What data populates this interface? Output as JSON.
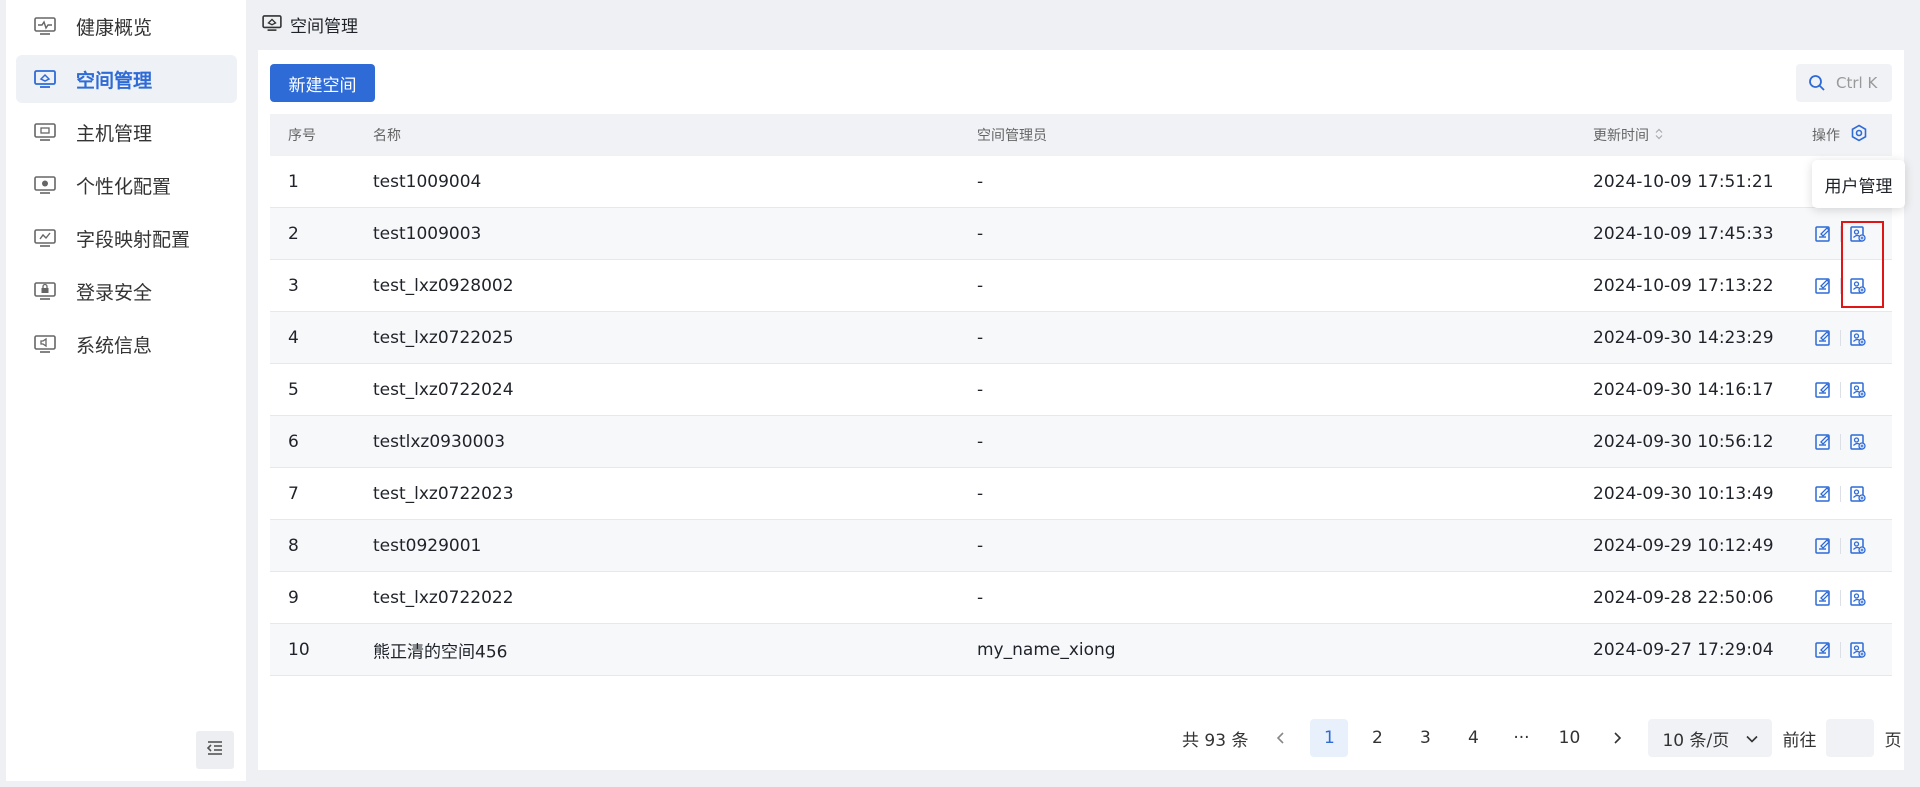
{
  "sidebar": {
    "items": [
      {
        "label": "健康概览",
        "icon": "health-monitor-icon",
        "active": false
      },
      {
        "label": "空间管理",
        "icon": "space-icon",
        "active": true
      },
      {
        "label": "主机管理",
        "icon": "host-icon",
        "active": false
      },
      {
        "label": "个性化配置",
        "icon": "config-icon",
        "active": false
      },
      {
        "label": "字段映射配置",
        "icon": "field-mapping-icon",
        "active": false
      },
      {
        "label": "登录安全",
        "icon": "login-security-icon",
        "active": false
      },
      {
        "label": "系统信息",
        "icon": "system-info-icon",
        "active": false
      }
    ],
    "collapse_icon": "collapse-sidebar-icon"
  },
  "header": {
    "title": "空间管理"
  },
  "toolbar": {
    "new_space_label": "新建空间",
    "search_placeholder": "Ctrl K"
  },
  "table": {
    "columns": {
      "index": "序号",
      "name": "名称",
      "admin": "空间管理员",
      "updated": "更新时间",
      "actions": "操作"
    },
    "rows": [
      {
        "index": "1",
        "name": "test1009004",
        "admin": "-",
        "updated": "2024-10-09 17:51:21"
      },
      {
        "index": "2",
        "name": "test1009003",
        "admin": "-",
        "updated": "2024-10-09 17:45:33"
      },
      {
        "index": "3",
        "name": "test_lxz0928002",
        "admin": "-",
        "updated": "2024-10-09 17:13:22"
      },
      {
        "index": "4",
        "name": "test_lxz0722025",
        "admin": "-",
        "updated": "2024-09-30 14:23:29"
      },
      {
        "index": "5",
        "name": "test_lxz0722024",
        "admin": "-",
        "updated": "2024-09-30 14:16:17"
      },
      {
        "index": "6",
        "name": "testlxz0930003",
        "admin": "-",
        "updated": "2024-09-30 10:56:12"
      },
      {
        "index": "7",
        "name": "test_lxz0722023",
        "admin": "-",
        "updated": "2024-09-30 10:13:49"
      },
      {
        "index": "8",
        "name": "test0929001",
        "admin": "-",
        "updated": "2024-09-29 10:12:49"
      },
      {
        "index": "9",
        "name": "test_lxz0722022",
        "admin": "-",
        "updated": "2024-09-28 22:50:06"
      },
      {
        "index": "10",
        "name": "熊正清的空间456",
        "admin": "my_name_xiong",
        "updated": "2024-09-27 17:29:04"
      }
    ]
  },
  "tooltip": {
    "text": "用户管理"
  },
  "pagination": {
    "total_text": "共 93 条",
    "pages": [
      "1",
      "2",
      "3",
      "4",
      "···",
      "10"
    ],
    "current": "1",
    "page_size": "10 条/页",
    "goto_label": "前往",
    "page_suffix": "页"
  },
  "colors": {
    "primary": "#2f6bd6",
    "highlight": "#e01515"
  }
}
